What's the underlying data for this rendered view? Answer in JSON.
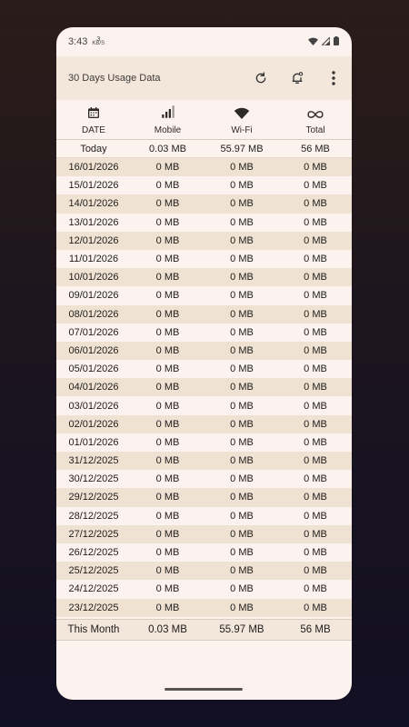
{
  "status_bar": {
    "time": "3:43",
    "notif_top": "3",
    "notif_bottom": "KB/S",
    "icons": [
      "wifi-icon",
      "cell-signal-icon",
      "battery-icon"
    ]
  },
  "app_bar": {
    "title": "30 Days Usage Data",
    "actions": [
      "refresh-icon",
      "notification-settings-icon",
      "more-vert-icon"
    ]
  },
  "columns": [
    {
      "label": "DATE",
      "icon": "calendar-icon"
    },
    {
      "label": "Mobile",
      "icon": "signal-bars-icon"
    },
    {
      "label": "Wi-Fi",
      "icon": "wifi-icon"
    },
    {
      "label": "Total",
      "icon": "infinity-icon"
    }
  ],
  "today": {
    "label": "Today",
    "mobile": "0.03 MB",
    "wifi": "55.97 MB",
    "total": "56 MB"
  },
  "rows": [
    {
      "date": "16/01/2026",
      "mobile": "0 MB",
      "wifi": "0 MB",
      "total": "0 MB"
    },
    {
      "date": "15/01/2026",
      "mobile": "0 MB",
      "wifi": "0 MB",
      "total": "0 MB"
    },
    {
      "date": "14/01/2026",
      "mobile": "0 MB",
      "wifi": "0 MB",
      "total": "0 MB"
    },
    {
      "date": "13/01/2026",
      "mobile": "0 MB",
      "wifi": "0 MB",
      "total": "0 MB"
    },
    {
      "date": "12/01/2026",
      "mobile": "0 MB",
      "wifi": "0 MB",
      "total": "0 MB"
    },
    {
      "date": "11/01/2026",
      "mobile": "0 MB",
      "wifi": "0 MB",
      "total": "0 MB"
    },
    {
      "date": "10/01/2026",
      "mobile": "0 MB",
      "wifi": "0 MB",
      "total": "0 MB"
    },
    {
      "date": "09/01/2026",
      "mobile": "0 MB",
      "wifi": "0 MB",
      "total": "0 MB"
    },
    {
      "date": "08/01/2026",
      "mobile": "0 MB",
      "wifi": "0 MB",
      "total": "0 MB"
    },
    {
      "date": "07/01/2026",
      "mobile": "0 MB",
      "wifi": "0 MB",
      "total": "0 MB"
    },
    {
      "date": "06/01/2026",
      "mobile": "0 MB",
      "wifi": "0 MB",
      "total": "0 MB"
    },
    {
      "date": "05/01/2026",
      "mobile": "0 MB",
      "wifi": "0 MB",
      "total": "0 MB"
    },
    {
      "date": "04/01/2026",
      "mobile": "0 MB",
      "wifi": "0 MB",
      "total": "0 MB"
    },
    {
      "date": "03/01/2026",
      "mobile": "0 MB",
      "wifi": "0 MB",
      "total": "0 MB"
    },
    {
      "date": "02/01/2026",
      "mobile": "0 MB",
      "wifi": "0 MB",
      "total": "0 MB"
    },
    {
      "date": "01/01/2026",
      "mobile": "0 MB",
      "wifi": "0 MB",
      "total": "0 MB"
    },
    {
      "date": "31/12/2025",
      "mobile": "0 MB",
      "wifi": "0 MB",
      "total": "0 MB"
    },
    {
      "date": "30/12/2025",
      "mobile": "0 MB",
      "wifi": "0 MB",
      "total": "0 MB"
    },
    {
      "date": "29/12/2025",
      "mobile": "0 MB",
      "wifi": "0 MB",
      "total": "0 MB"
    },
    {
      "date": "28/12/2025",
      "mobile": "0 MB",
      "wifi": "0 MB",
      "total": "0 MB"
    },
    {
      "date": "27/12/2025",
      "mobile": "0 MB",
      "wifi": "0 MB",
      "total": "0 MB"
    },
    {
      "date": "26/12/2025",
      "mobile": "0 MB",
      "wifi": "0 MB",
      "total": "0 MB"
    },
    {
      "date": "25/12/2025",
      "mobile": "0 MB",
      "wifi": "0 MB",
      "total": "0 MB"
    },
    {
      "date": "24/12/2025",
      "mobile": "0 MB",
      "wifi": "0 MB",
      "total": "0 MB"
    },
    {
      "date": "23/12/2025",
      "mobile": "0 MB",
      "wifi": "0 MB",
      "total": "0 MB"
    }
  ],
  "this_month": {
    "label": "This Month",
    "mobile": "0.03 MB",
    "wifi": "55.97 MB",
    "total": "56 MB"
  },
  "colors": {
    "surface": "#fcf3ee",
    "app_bar": "#f3e7dc",
    "stripe": "#efe2d2",
    "text": "#1f1c1a"
  }
}
